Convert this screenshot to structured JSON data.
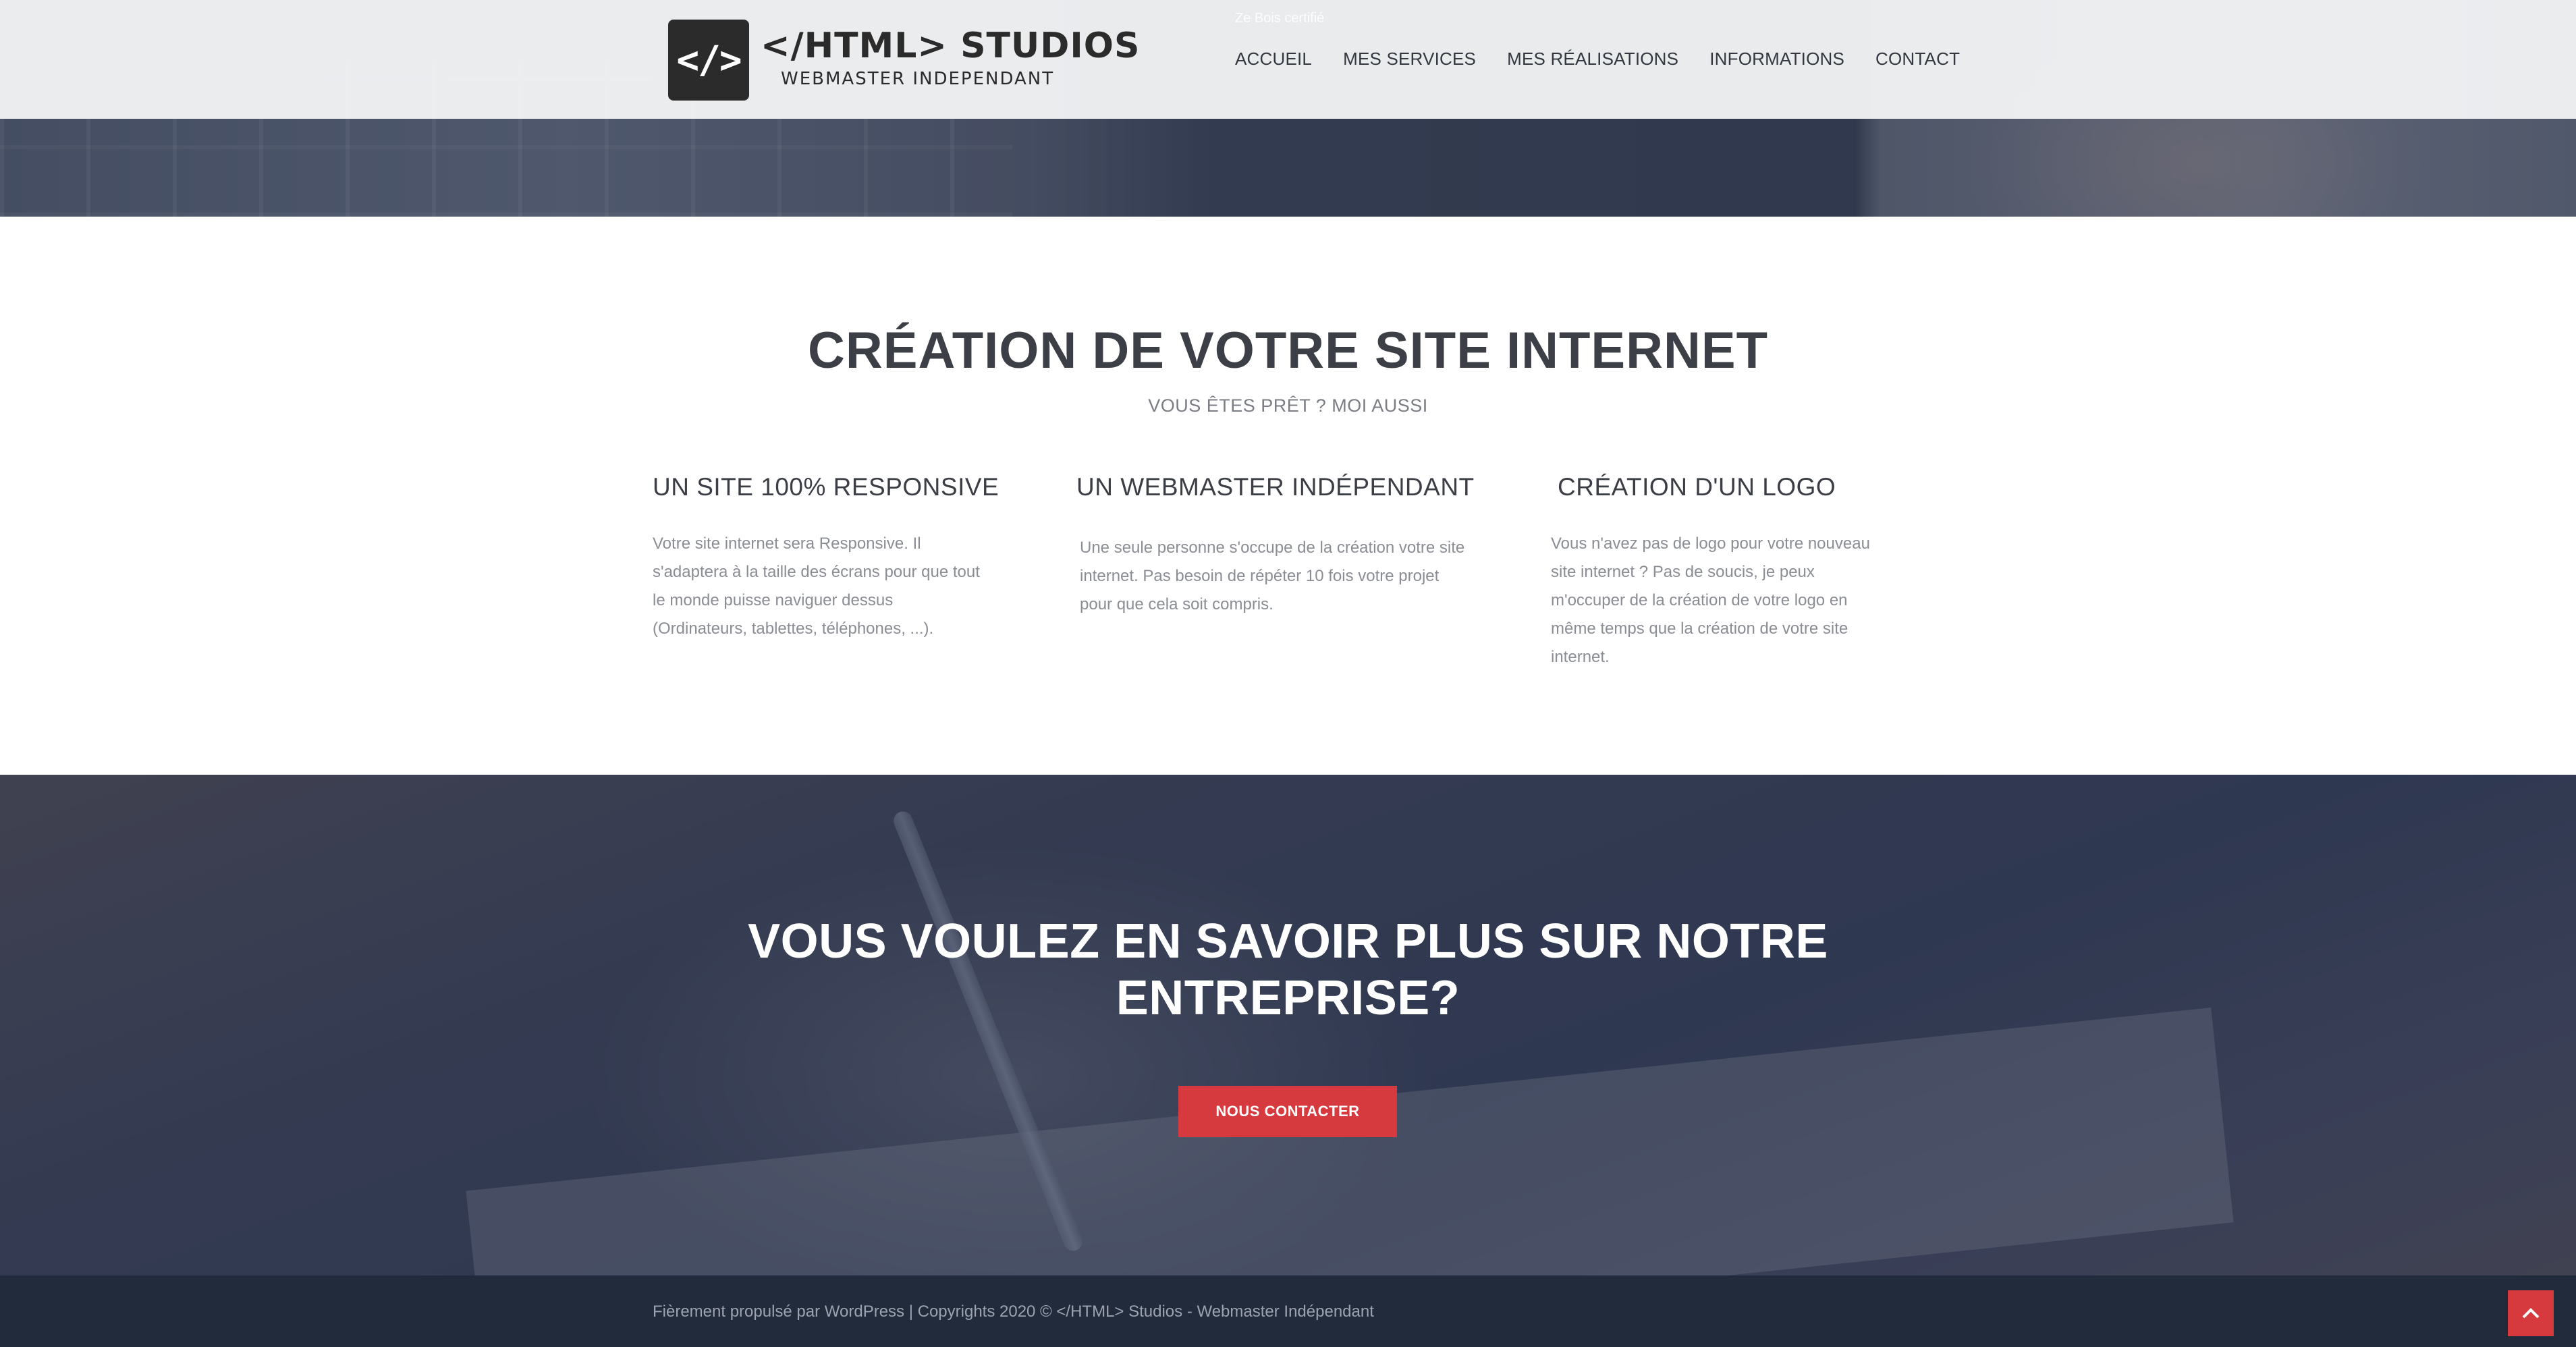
{
  "header": {
    "logo_mark": "</>",
    "logo_title": "</HTML> STUDIOS",
    "logo_subtitle": "WEBMASTER INDEPENDANT",
    "top_note": "Ze Bois certifié",
    "nav": [
      {
        "label": "ACCUEIL"
      },
      {
        "label": "MES SERVICES"
      },
      {
        "label": "MES RÉALISATIONS"
      },
      {
        "label": "INFORMATIONS"
      },
      {
        "label": "CONTACT"
      }
    ]
  },
  "main": {
    "title": "CRÉATION DE VOTRE SITE INTERNET",
    "subtitle": "VOUS ÊTES PRÊT ? MOI AUSSI",
    "features": [
      {
        "heading": "UN SITE 100% RESPONSIVE",
        "text": "Votre site internet sera Responsive. Il s'adaptera à la taille des écrans pour que tout le monde puisse naviguer dessus (Ordinateurs, tablettes, téléphones, ...)."
      },
      {
        "heading": "UN WEBMASTER INDÉPENDANT",
        "text": "Une seule personne s'occupe de la création votre site internet. Pas besoin de répéter 10 fois votre projet pour que cela soit compris."
      },
      {
        "heading": "CRÉATION D'UN LOGO",
        "text": "Vous n'avez pas de logo pour votre nouveau site internet ? Pas de soucis, je peux m'occuper de la création de votre logo en même temps que la création de votre site internet."
      }
    ]
  },
  "cta": {
    "title": "VOUS VOULEZ EN SAVOIR PLUS SUR NOTRE ENTREPRISE?",
    "button_label": "NOUS CONTACTER"
  },
  "footer": {
    "text": "Fièrement propulsé par WordPress | Copyrights 2020 © </HTML> Studios - Webmaster Indépendant",
    "to_top_icon": "chevron-up-icon"
  },
  "colors": {
    "accent": "#d63a3e",
    "header_bg": "#f3f4f6",
    "footer_bg": "#222b3b",
    "heading_text": "#3c3f46"
  }
}
